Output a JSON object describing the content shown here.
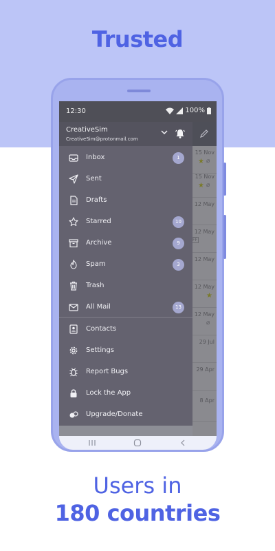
{
  "headline": "Trusted",
  "caption": {
    "line1": "Users in",
    "line2": "180 countries"
  },
  "status_bar": {
    "time": "12:30",
    "battery": "100%"
  },
  "account": {
    "name": "CreativeSim",
    "email": "CreativeSim@protonmail.com"
  },
  "menu": [
    {
      "label": "Inbox",
      "icon": "inbox-icon",
      "badge": "1"
    },
    {
      "label": "Sent",
      "icon": "send-icon",
      "badge": ""
    },
    {
      "label": "Drafts",
      "icon": "draft-icon",
      "badge": ""
    },
    {
      "label": "Starred",
      "icon": "star-icon",
      "badge": "10"
    },
    {
      "label": "Archive",
      "icon": "archive-icon",
      "badge": "9"
    },
    {
      "label": "Spam",
      "icon": "spam-icon",
      "badge": "3"
    },
    {
      "label": "Trash",
      "icon": "trash-icon",
      "badge": ""
    },
    {
      "label": "All Mail",
      "icon": "mail-icon",
      "badge": "13"
    }
  ],
  "menu_secondary": [
    {
      "label": "Contacts",
      "icon": "contacts-icon"
    },
    {
      "label": "Settings",
      "icon": "gear-icon"
    },
    {
      "label": "Report Bugs",
      "icon": "bug-icon"
    },
    {
      "label": "Lock the App",
      "icon": "lock-icon"
    },
    {
      "label": "Upgrade/Donate",
      "icon": "donate-icon"
    }
  ],
  "background_list_dates": [
    "15 Nov",
    "15 Nov",
    "12 May",
    "12 May",
    "12 May",
    "12 May",
    "12 May",
    "29 Jul",
    "29 Apr",
    "8 Apr"
  ],
  "colors": {
    "accent": "#4f63e3",
    "band": "#bcc5f7",
    "phone": "#a9b3f0",
    "drawer": "#64626f"
  }
}
